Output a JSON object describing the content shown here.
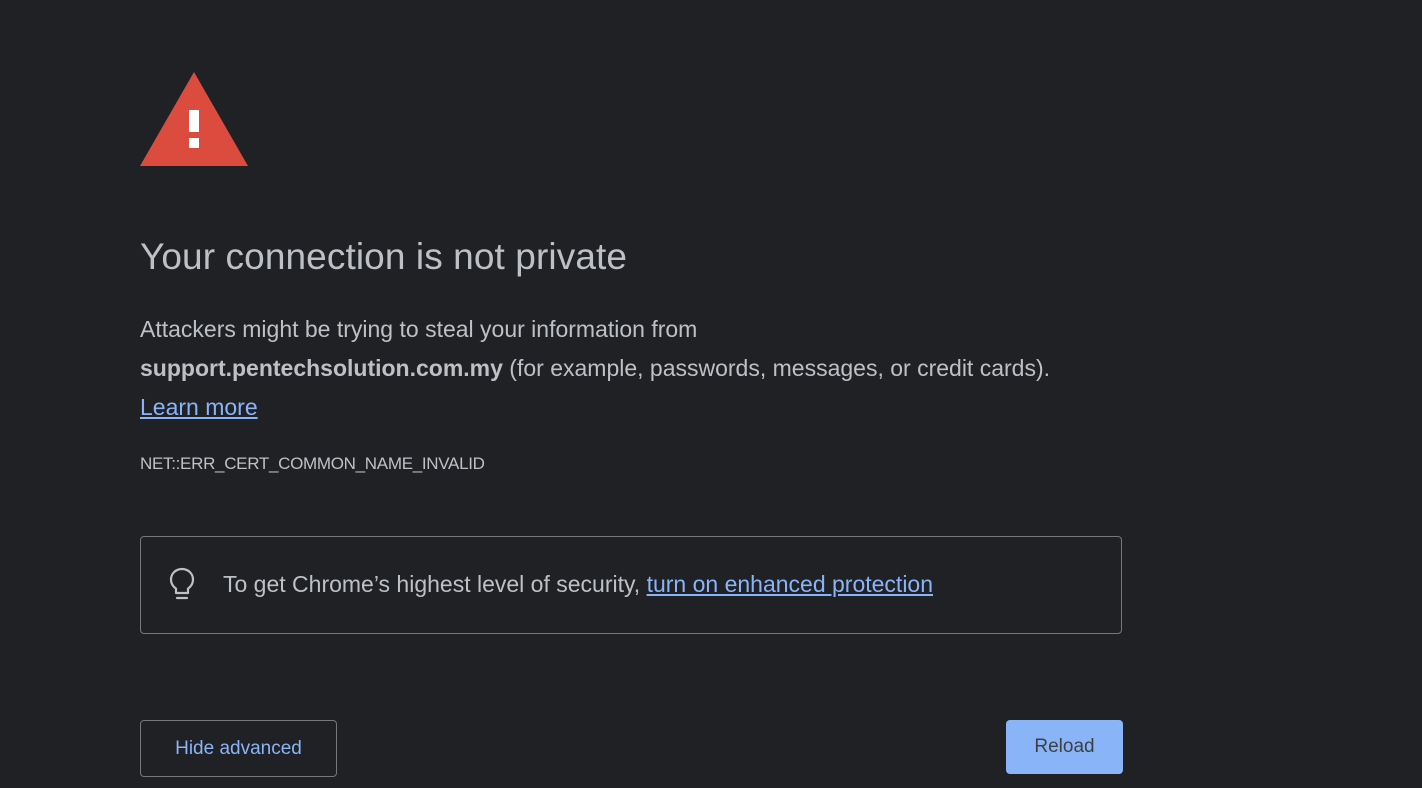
{
  "page": {
    "title": "Your connection is not private",
    "message_prefix": "Attackers might be trying to steal your information from",
    "host": "support.pentechsolution.com.my",
    "message_suffix": " (for example, passwords, messages, or credit cards).",
    "learn_more": "Learn more",
    "error_code": "NET::ERR_CERT_COMMON_NAME_INVALID",
    "icon": "warning-triangle-icon"
  },
  "enhanced_protection": {
    "text": "To get Chrome’s highest level of security, ",
    "link": "turn on enhanced protection",
    "icon": "lightbulb-icon"
  },
  "buttons": {
    "hide_advanced": "Hide advanced",
    "reload": "Reload"
  },
  "colors": {
    "background": "#202124",
    "text": "#bdc1c6",
    "link": "#8ab4f8",
    "warning_red": "#db4c3f",
    "primary_button": "#8ab4f8"
  }
}
